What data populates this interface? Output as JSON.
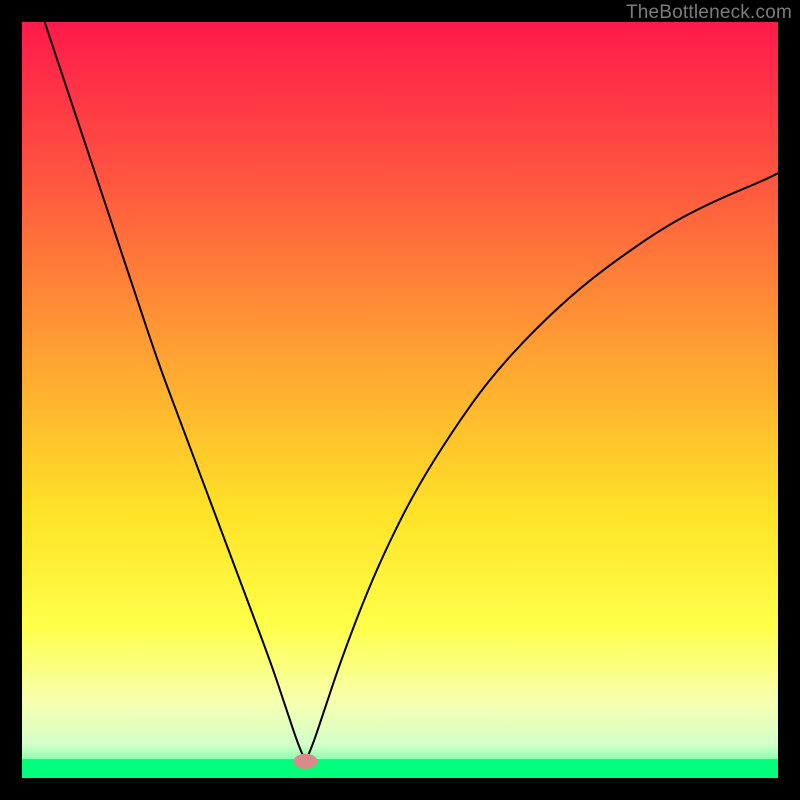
{
  "watermark": "TheBottleneck.com",
  "chart_data": {
    "type": "line",
    "title": "",
    "xlabel": "",
    "ylabel": "",
    "xlim": [
      0,
      100
    ],
    "ylim": [
      0,
      100
    ],
    "grid": false,
    "legend": false,
    "gradient_stops": [
      {
        "offset": 0,
        "color": "#ff1a4b"
      },
      {
        "offset": 0.2,
        "color": "#ff5340"
      },
      {
        "offset": 0.45,
        "color": "#ffa531"
      },
      {
        "offset": 0.65,
        "color": "#ffe327"
      },
      {
        "offset": 0.8,
        "color": "#ffff4a"
      },
      {
        "offset": 0.9,
        "color": "#f6ffb0"
      },
      {
        "offset": 0.955,
        "color": "#d4ffc9"
      },
      {
        "offset": 0.975,
        "color": "#8fffb0"
      },
      {
        "offset": 1.0,
        "color": "#00ff7a"
      }
    ],
    "background_band": {
      "color": "#00ff7a",
      "y_from": 97.5,
      "y_to": 100
    },
    "marker": {
      "x": 37.5,
      "y": 97.8,
      "rx": 1.6,
      "ry": 1.0,
      "color": "#d98a8a"
    },
    "series": [
      {
        "name": "curve",
        "color": "#000000",
        "width": 2,
        "x": [
          3,
          6,
          9,
          12,
          15,
          18,
          21,
          24,
          27,
          30,
          33,
          35,
          36.5,
          37.5,
          38.5,
          40,
          42,
          45,
          48,
          52,
          57,
          62,
          68,
          74,
          80,
          86,
          92,
          98,
          100
        ],
        "y": [
          0,
          9,
          18,
          27,
          36,
          45,
          53,
          61,
          69,
          77,
          85,
          91,
          95.5,
          97.8,
          95.5,
          91,
          85,
          77,
          70,
          62,
          54,
          47,
          40.5,
          35,
          30.5,
          26.5,
          23.5,
          21,
          20
        ]
      }
    ]
  }
}
